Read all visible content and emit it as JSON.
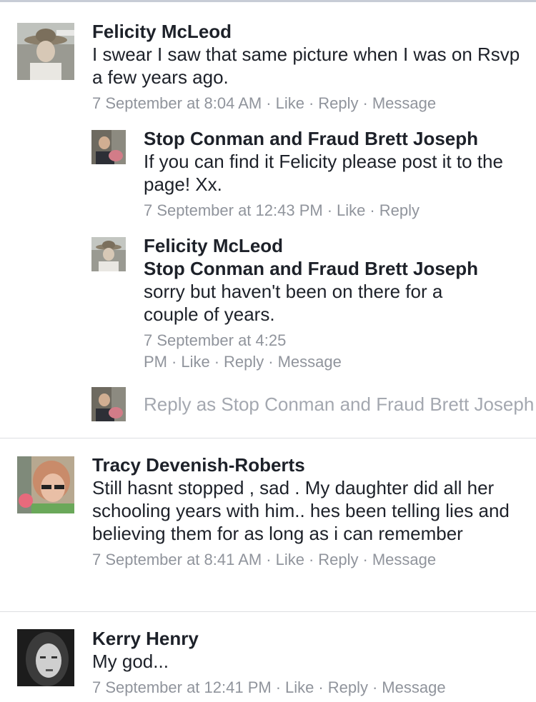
{
  "comments": [
    {
      "author": "Felicity McLeod",
      "text": "I swear I saw that same picture when I was on Rsvp a few years ago.",
      "time": "7 September at 8:04 AM",
      "actions": [
        "Like",
        "Reply",
        "Message"
      ]
    },
    {
      "author": "Stop Conman and Fraud Brett Joseph",
      "text": "If you can find it Felicity please post it to the page! Xx.",
      "time": "7 September at 12:43 PM",
      "actions": [
        "Like",
        "Reply"
      ]
    },
    {
      "author": "Felicity McLeod",
      "mention": "Stop Conman and Fraud Brett Joseph",
      "text": "sorry but haven't been on there for a couple of years.",
      "time": "7 September at 4:25 PM",
      "actions": [
        "Like",
        "Reply",
        "Message"
      ]
    },
    {
      "author": "Tracy Devenish-Roberts",
      "text": "Still hasnt stopped , sad . My daughter did all her schooling years with him.. hes been telling lies and believing them for as long as i can remember",
      "time": "7 September at 8:41 AM",
      "actions": [
        "Like",
        "Reply",
        "Message"
      ]
    },
    {
      "author": "Kerry Henry",
      "text": "My god...",
      "time": "7 September at 12:41 PM",
      "actions": [
        "Like",
        "Reply",
        "Message"
      ]
    }
  ],
  "reply_box": {
    "placeholder": "Reply as Stop Conman and Fraud Brett Joseph"
  },
  "separator": "·"
}
